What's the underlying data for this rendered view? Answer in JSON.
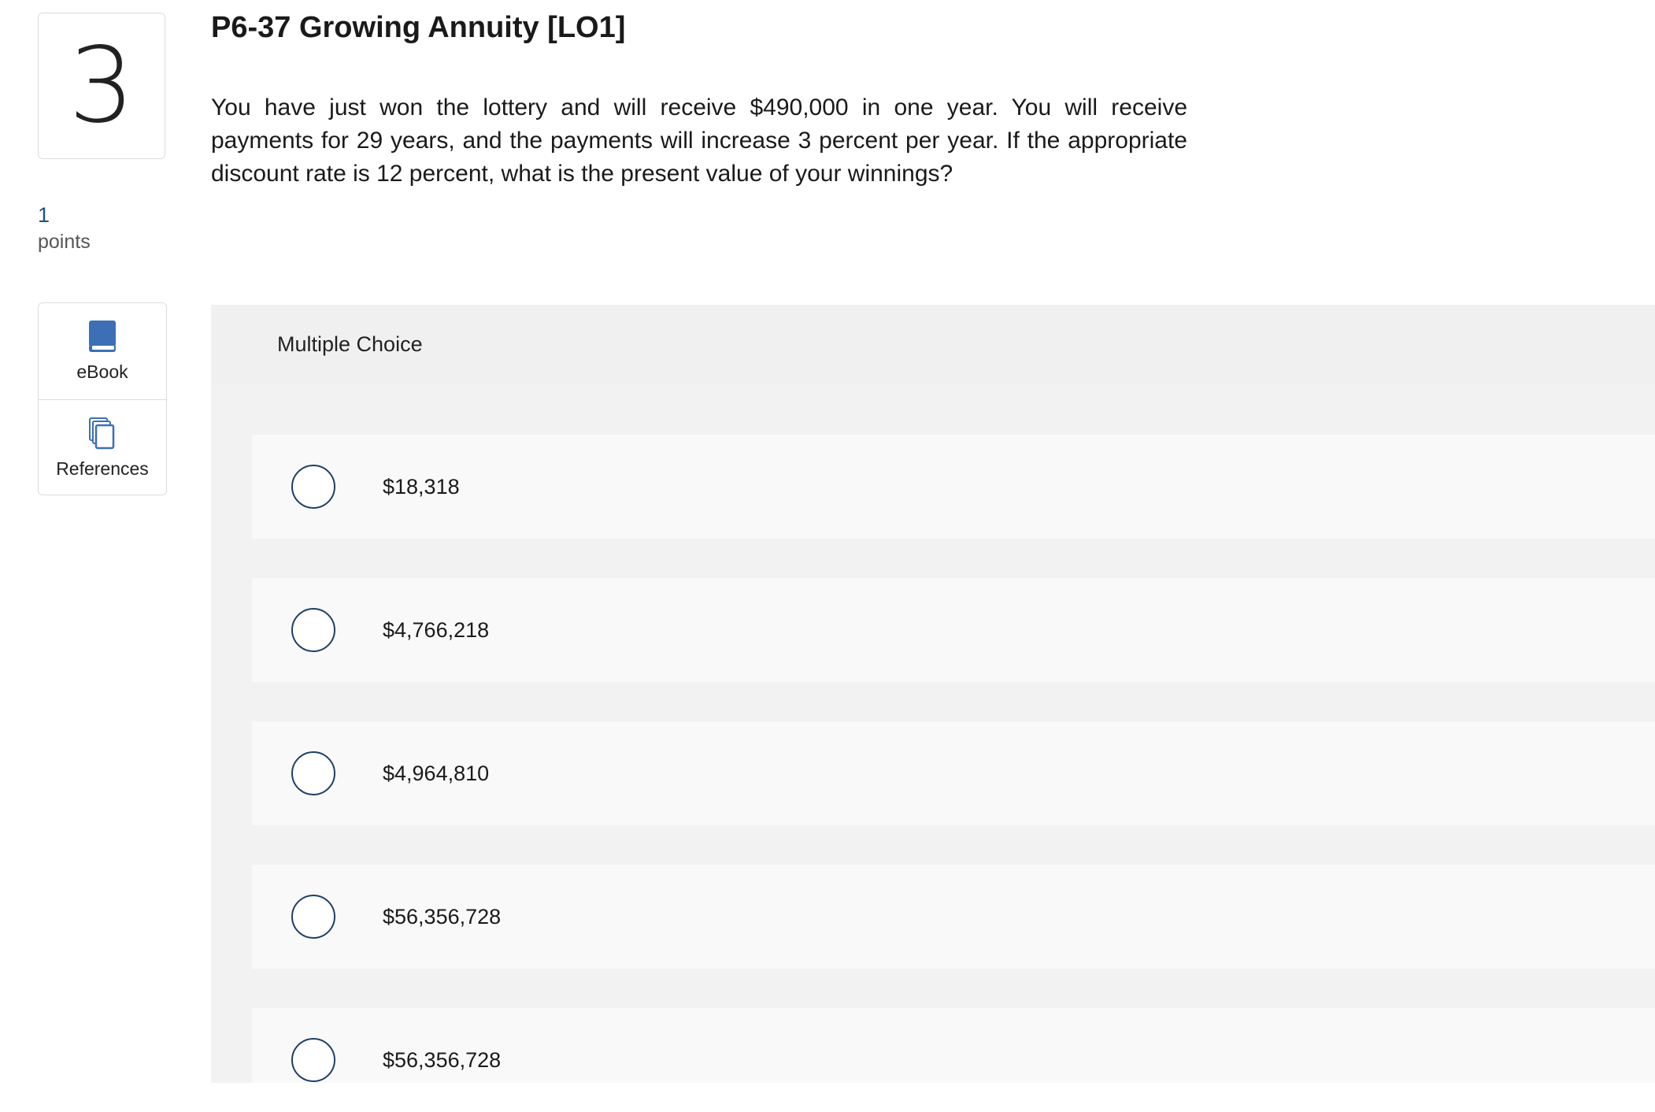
{
  "question": {
    "number": "3",
    "points_value": "1",
    "points_label": "points",
    "title": "P6-37 Growing Annuity [LO1]",
    "text": "You have just won the lottery and will receive $490,000 in one year. You will receive payments for 29 years, and the payments will increase 3 percent per year. If the appropriate discount rate is 12 percent, what is the present value of your winnings?"
  },
  "tools": {
    "ebook": {
      "label": "eBook",
      "icon": "book-icon",
      "color": "#3d6fb6"
    },
    "references": {
      "label": "References",
      "icon": "copy-pages-icon",
      "color": "#3d6fb6"
    }
  },
  "multiple_choice": {
    "header": "Multiple Choice",
    "options": [
      {
        "label": "$18,318"
      },
      {
        "label": "$4,766,218"
      },
      {
        "label": "$4,964,810"
      },
      {
        "label": "$56,356,728"
      },
      {
        "label": "$56,356,728"
      }
    ]
  }
}
